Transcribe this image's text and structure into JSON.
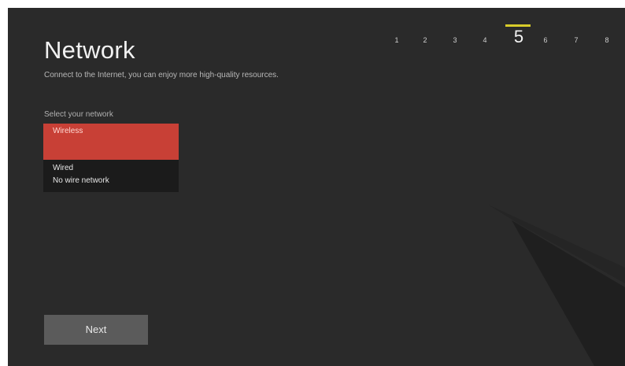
{
  "page": {
    "title": "Network",
    "subtitle": "Connect to the Internet, you can enjoy more high-quality resources."
  },
  "steps": {
    "items": [
      "1",
      "2",
      "3",
      "4",
      "5",
      "6",
      "7",
      "8"
    ],
    "current": "5",
    "accent_color": "#d8cc2a"
  },
  "network": {
    "label": "Select your network",
    "options": [
      "Wireless",
      "Wired",
      "No wire network"
    ],
    "selected": "Wireless",
    "selected_color": "#c84036"
  },
  "footer": {
    "next_label": "Next"
  }
}
